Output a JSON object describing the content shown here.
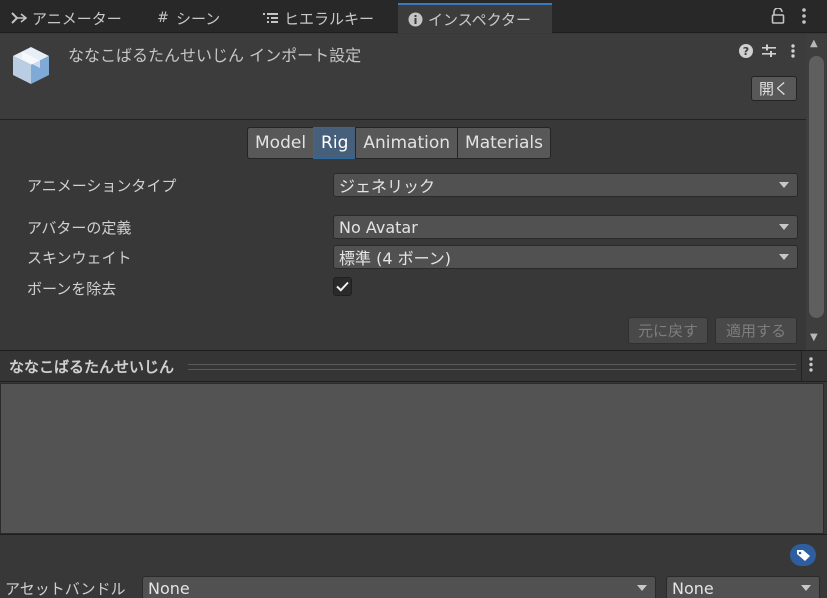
{
  "tabs": [
    {
      "label": "アニメーター",
      "icon": "animator-icon"
    },
    {
      "label": "シーン",
      "icon": "scene-hash-icon"
    },
    {
      "label": "ヒエラルキー",
      "icon": "hierarchy-icon"
    },
    {
      "label": "インスペクター",
      "icon": "info-icon",
      "active": true
    }
  ],
  "header": {
    "title": "ななこばるたんせいじん インポート設定",
    "open_label": "開く"
  },
  "import_tabs": [
    {
      "label": "Model"
    },
    {
      "label": "Rig",
      "active": true
    },
    {
      "label": "Animation"
    },
    {
      "label": "Materials"
    }
  ],
  "rig": {
    "animation_type_label": "アニメーションタイプ",
    "animation_type_value": "ジェネリック",
    "avatar_def_label": "アバターの定義",
    "avatar_def_value": "No Avatar",
    "skin_weights_label": "スキンウェイト",
    "skin_weights_value": "標準 (4 ボーン)",
    "strip_bones_label": "ボーンを除去",
    "strip_bones_checked": true
  },
  "actions": {
    "revert_label": "元に戻す",
    "apply_label": "適用する"
  },
  "preview": {
    "title": "ななこばるたんせいじん"
  },
  "asset_bundle": {
    "label": "アセットバンドル",
    "name_value": "None",
    "variant_value": "None"
  },
  "colors": {
    "accent": "#3a79bb",
    "active_segment": "#46607c",
    "label_badge": "#2e5ea0"
  }
}
